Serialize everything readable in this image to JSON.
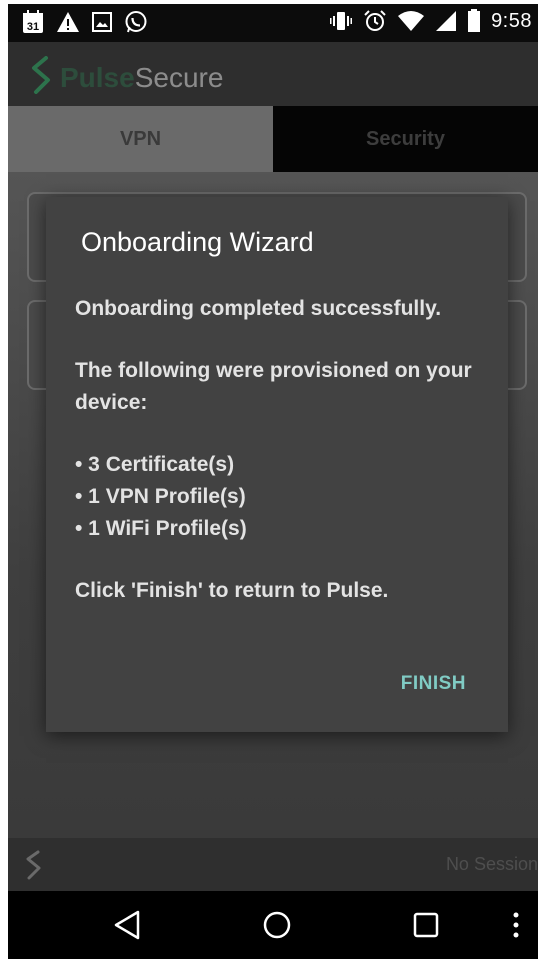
{
  "status_bar": {
    "time": "9:58",
    "calendar_day": "31",
    "left_icons": [
      "calendar-icon",
      "warning-icon",
      "image-icon",
      "whatsapp-icon"
    ],
    "right_icons": [
      "vibrate-icon",
      "alarm-icon",
      "wifi-icon",
      "signal-icon",
      "battery-icon"
    ]
  },
  "app_bar": {
    "logo_pulse": "Pulse",
    "logo_secure": "Secure"
  },
  "tabs": [
    {
      "label": "VPN",
      "selected": true
    },
    {
      "label": "Security",
      "selected": false
    }
  ],
  "dialog": {
    "title": "Onboarding Wizard",
    "line1": "Onboarding completed successfully.",
    "line2": "The following were provisioned on your device:",
    "items": [
      "• 3 Certificate(s)",
      "• 1 VPN Profile(s)",
      "• 1 WiFi Profile(s)"
    ],
    "line3": "Click 'Finish' to return to Pulse.",
    "finish_label": "FINISH"
  },
  "session_bar": {
    "status": "No Session"
  },
  "nav_bar": {
    "buttons": [
      "back-icon",
      "home-icon",
      "recents-icon",
      "overflow-menu-icon"
    ]
  },
  "colors": {
    "accent": "#80cbc4",
    "brand_green": "#2e8b57"
  }
}
